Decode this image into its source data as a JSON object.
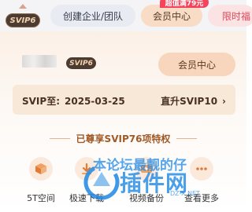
{
  "topbar": {
    "svip_chip": "SVIP6",
    "tabs": [
      {
        "label": "创建企业/团队"
      },
      {
        "label": "会员中心"
      },
      {
        "label": "限时福"
      }
    ],
    "promo_badge": "超值满79元"
  },
  "panel": {
    "svip_badge": "SVIP6",
    "member_center_button": "会员中心",
    "expiry": {
      "label": "SVIP至:",
      "date": "2025-03-25",
      "upgrade_link": "直升SVIP10"
    },
    "benefit_title": "已尊享SVIP76项特权",
    "features": [
      {
        "label": "5T空间",
        "icon": "cube-storage-icon"
      },
      {
        "label": "极速下载",
        "icon": "fast-download-icon"
      },
      {
        "label": "视频备份",
        "icon": "video-backup-icon"
      },
      {
        "label": "查看更多",
        "icon": "more-icon"
      }
    ]
  },
  "watermark": {
    "line1": "本论坛最靓的仔",
    "brand": "插件网",
    "url": "DZ-X.NET"
  },
  "colors": {
    "svip_dark": "#4b3b31",
    "svip_gold": "#f2d2b0",
    "member_peach": "#f7d6bd",
    "promo_red": "#f4435a",
    "benefit_brown": "#a05a28",
    "watermark_blue": "#1e88e5"
  }
}
